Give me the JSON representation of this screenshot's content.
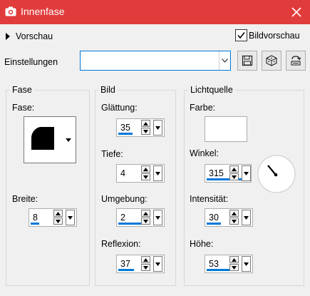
{
  "window": {
    "title": "Innenfase"
  },
  "preview": {
    "toggle_label": "Vorschau",
    "bildvorschau_label": "Bildvorschau",
    "bildvorschau_checked": true
  },
  "settings": {
    "label": "Einstellungen",
    "value": ""
  },
  "fase": {
    "group_title": "Fase",
    "fase_label": "Fase:",
    "breite_label": "Breite:",
    "breite_value": "8"
  },
  "bild": {
    "group_title": "Bild",
    "glaettung_label": "Glättung:",
    "glaettung_value": "35",
    "tiefe_label": "Tiefe:",
    "tiefe_value": "4",
    "umgebung_label": "Umgebung:",
    "umgebung_value": "2",
    "reflexion_label": "Reflexion:",
    "reflexion_value": "37"
  },
  "licht": {
    "group_title": "Lichtquelle",
    "farbe_label": "Farbe:",
    "farbe_color": "#ffffff",
    "winkel_label": "Winkel:",
    "winkel_value": "315",
    "intensitaet_label": "Intensität:",
    "intensitaet_value": "30",
    "hoehe_label": "Höhe:",
    "hoehe_value": "53"
  },
  "colors": {
    "titlebar": "#e13c3c",
    "accent": "#0078d7"
  }
}
